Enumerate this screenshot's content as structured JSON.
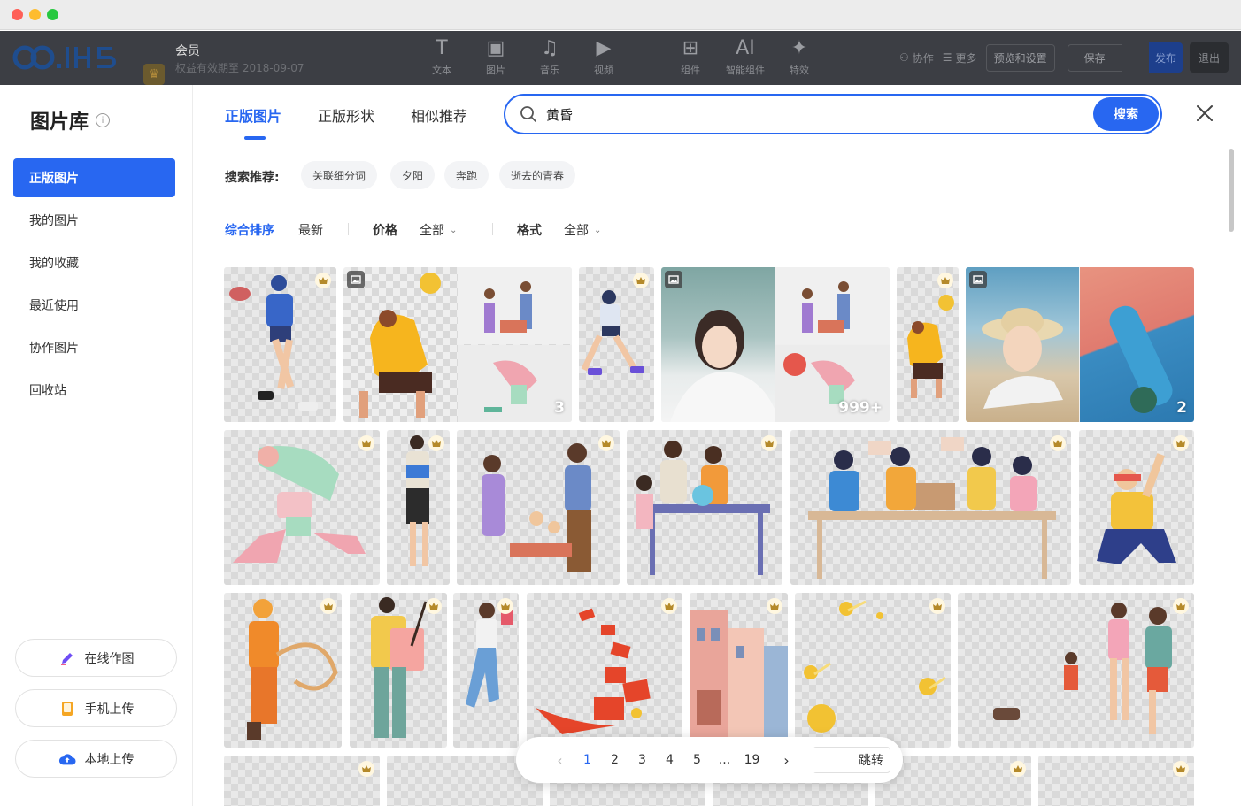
{
  "window": {
    "traffic_lights": [
      "close",
      "minimize",
      "zoom"
    ]
  },
  "editor": {
    "logo_text": "CO.IH5",
    "member_title": "会员",
    "member_subtitle": "权益有效期至 2018-09-07",
    "tools": [
      {
        "icon": "text-icon",
        "label": "文本"
      },
      {
        "icon": "image-icon",
        "label": "图片"
      },
      {
        "icon": "music-icon",
        "label": "音乐"
      },
      {
        "icon": "video-icon",
        "label": "视频"
      },
      {
        "icon": "components-icon",
        "label": "组件"
      },
      {
        "icon": "ai-icon",
        "label": "智能组件"
      },
      {
        "icon": "sparkle-icon",
        "label": "特效"
      }
    ],
    "collab_label": "协作",
    "more_label": "更多",
    "preview_settings_label": "预览和设置",
    "save_label": "保存",
    "publish_label": "发布",
    "exit_label": "退出"
  },
  "library": {
    "title": "图片库",
    "nav": [
      {
        "label": "正版图片",
        "active": true
      },
      {
        "label": "我的图片",
        "active": false
      },
      {
        "label": "我的收藏",
        "active": false
      },
      {
        "label": "最近使用",
        "active": false
      },
      {
        "label": "协作图片",
        "active": false
      },
      {
        "label": "回收站",
        "active": false
      }
    ],
    "actions": [
      {
        "label": "在线作图",
        "icon": "pen-icon",
        "color": "#6f4ef5"
      },
      {
        "label": "手机上传",
        "icon": "phone-icon",
        "color": "#f5a623"
      },
      {
        "label": "本地上传",
        "icon": "cloud-upload-icon",
        "color": "#2867f1"
      }
    ]
  },
  "tabs": [
    {
      "label": "正版图片",
      "active": true
    },
    {
      "label": "正版形状",
      "active": false
    },
    {
      "label": "相似推荐",
      "active": false
    }
  ],
  "search": {
    "value": "黄昏",
    "placeholder": "",
    "button_label": "搜索"
  },
  "recommend": {
    "label": "搜索推荐:",
    "chips": [
      "关联细分词",
      "夕阳",
      "奔跑",
      "逝去的青春"
    ]
  },
  "filters": {
    "sort_options": [
      "综合排序",
      "最新"
    ],
    "active_sort": "综合排序",
    "price_label": "价格",
    "price_value": "全部",
    "format_label": "格式",
    "format_value": "全部"
  },
  "grid": {
    "group_counts": [
      "3",
      "999+",
      "2"
    ]
  },
  "pagination": {
    "pages": [
      "1",
      "2",
      "3",
      "4",
      "5",
      "...",
      "19"
    ],
    "current": "1",
    "jump_label": "跳转"
  },
  "colors": {
    "accent": "#2867f1",
    "crown": "#b58a2a"
  }
}
